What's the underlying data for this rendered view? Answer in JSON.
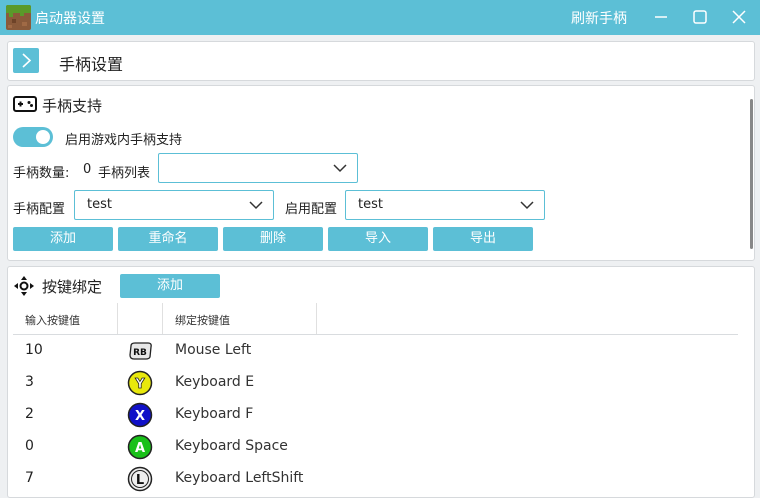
{
  "window": {
    "title": "启动器设置",
    "title_action": "刷新手柄",
    "controls": [
      "minimize-icon",
      "maximize-icon",
      "close-icon"
    ]
  },
  "header": {
    "title": "手柄设置"
  },
  "support": {
    "section_title": "手柄支持",
    "enable_label": "启用游戏内手柄支持",
    "enabled": true,
    "count_label": "手柄数量:",
    "count_value": "0",
    "list_label": "手柄列表",
    "list_value": "",
    "config_label": "手柄配置",
    "config_value": "test",
    "active_label": "启用配置",
    "active_value": "test",
    "buttons": {
      "add": "添加",
      "rename": "重命名",
      "delete": "删除",
      "import": "导入",
      "export": "导出"
    }
  },
  "bindings": {
    "section_title": "按键绑定",
    "add_label": "添加",
    "columns": {
      "input": "输入按键值",
      "output": "绑定按键值"
    },
    "rows": [
      {
        "input": "10",
        "icon": "rb-button-icon",
        "output": "Mouse Left"
      },
      {
        "input": "3",
        "icon": "y-button-icon",
        "output": "Keyboard E"
      },
      {
        "input": "2",
        "icon": "x-button-icon",
        "output": "Keyboard F"
      },
      {
        "input": "0",
        "icon": "a-button-icon",
        "output": "Keyboard Space"
      },
      {
        "input": "7",
        "icon": "l-stick-icon",
        "output": "Keyboard LeftShift"
      }
    ]
  },
  "colors": {
    "accent": "#5cbfd6",
    "y": "#e8e80c",
    "x": "#1010c8",
    "a": "#19c019"
  }
}
